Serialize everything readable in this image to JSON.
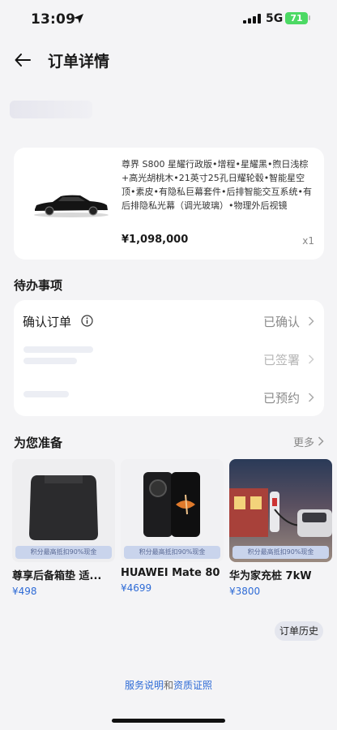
{
  "status": {
    "time": "13:09",
    "network": "5G",
    "battery": "71"
  },
  "nav": {
    "title": "订单详情"
  },
  "product": {
    "description": "尊界 S800 星耀行政版•增程•星耀黑•煦日浅棕+高光胡桃木•21英寸25孔日耀轮毂•智能星空顶•素皮•有隐私巨幕套件•后排智能交互系统•有后排隐私光幕（调光玻璃）•物理外后视镜",
    "price": "¥1,098,000",
    "qty": "x1"
  },
  "todo": {
    "title": "待办事项",
    "items": [
      {
        "label": "确认订单",
        "status": "已确认"
      },
      {
        "label": "",
        "status": "已签署"
      },
      {
        "label": "",
        "status": "已预约"
      }
    ]
  },
  "recs": {
    "title": "为您准备",
    "more": "更多",
    "banner": "积分最高抵扣90%现金",
    "items": [
      {
        "title": "尊享后备箱垫 适...",
        "price": "¥498"
      },
      {
        "title": "HUAWEI Mate 80",
        "price": "¥4699"
      },
      {
        "title": "华为家充桩 7kW",
        "price": "¥3800"
      }
    ]
  },
  "history_button": "订单历史",
  "footer": {
    "link1": "服务说明",
    "and": "和",
    "link2": "资质证照"
  },
  "colors": {
    "accent": "#2e6bd6",
    "battery": "#4cd964",
    "background": "#f4f4f6"
  }
}
